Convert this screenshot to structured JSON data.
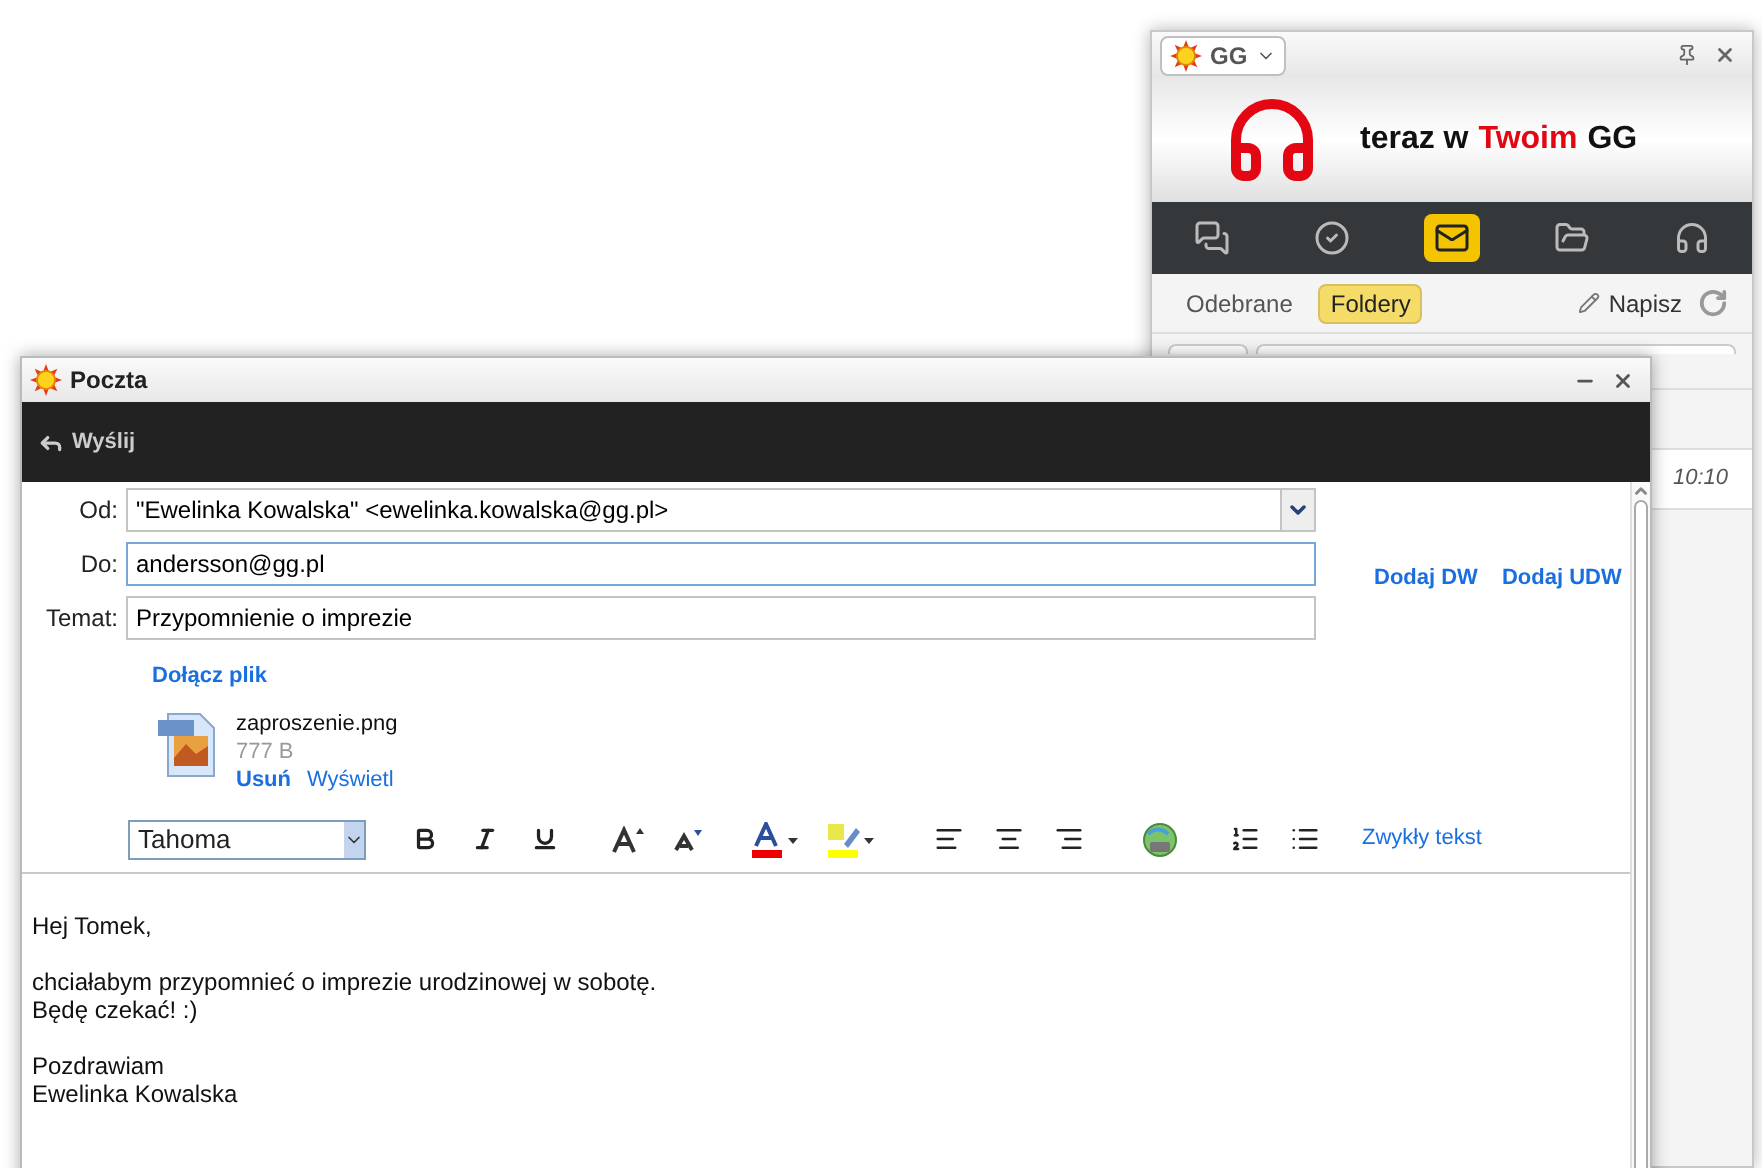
{
  "gg_window": {
    "title": "GG",
    "banner": [
      {
        "text": "teraz w",
        "highlight": false
      },
      {
        "text": "Twoim",
        "highlight": true
      },
      {
        "text": "GG",
        "highlight": false
      }
    ],
    "nav": [
      {
        "kind": "chats",
        "selected": false
      },
      {
        "kind": "status",
        "selected": false
      },
      {
        "kind": "mail",
        "selected": true
      },
      {
        "kind": "folder",
        "selected": false
      },
      {
        "kind": "music",
        "selected": false
      }
    ],
    "tabs": [
      {
        "label": "Odebrane",
        "selected": false
      },
      {
        "label": "Foldery",
        "selected": true
      }
    ],
    "compose": "Napisz",
    "message_time": "10:10"
  },
  "mail_window": {
    "title": "Poczta",
    "send": "Wyślij",
    "fields": [
      {
        "label": "Od:",
        "value": "\"Ewelinka Kowalska\" <ewelinka.kowalska@gg.pl>",
        "kind": "select",
        "focused": false
      },
      {
        "label": "Do:",
        "value": "andersson@gg.pl",
        "kind": "input",
        "focused": true
      },
      {
        "label": "Temat:",
        "value": "Przypomnienie o imprezie",
        "kind": "input",
        "focused": false
      }
    ],
    "cc_links": [
      "Dodaj DW",
      "Dodaj UDW"
    ],
    "attach_link": "Dołącz plik",
    "attachment": {
      "name": "zaproszenie.png",
      "size": "777 B",
      "remove": "Usuń",
      "view": "Wyświetl"
    },
    "font": "Tahoma",
    "plain_text": "Zwykły tekst",
    "body": [
      [
        "Hej Tomek,"
      ],
      [
        "chciałabym przypomnieć o imprezie urodzinowej w sobotę.",
        "Będę czekać! :)"
      ],
      [
        "Pozdrawiam",
        "Ewelinka Kowalska"
      ]
    ]
  }
}
